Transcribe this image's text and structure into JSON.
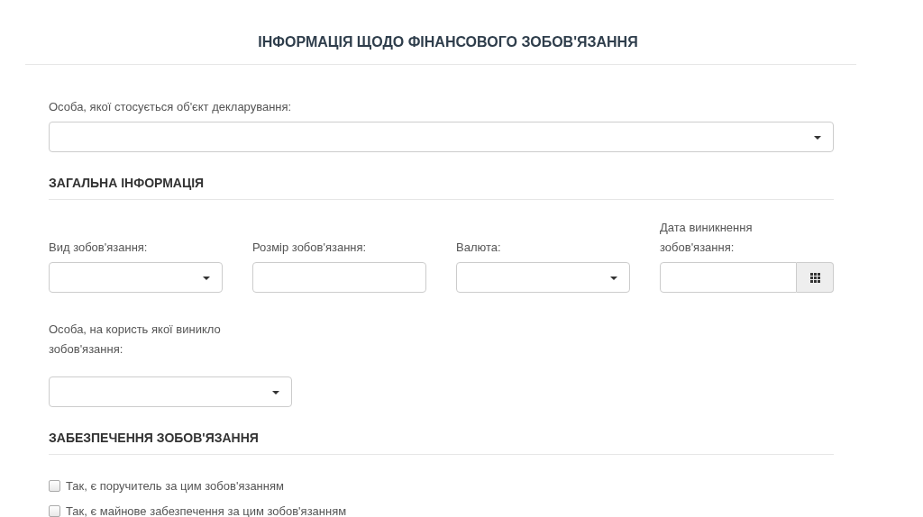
{
  "title": "ІНФОРМАЦІЯ ЩОДО ФІНАНСОВОГО ЗОБОВ'ЯЗАННЯ",
  "person_field": {
    "label": "Особа, якої стосується об'єкт декларування:",
    "kind": "select"
  },
  "sections": [
    {
      "heading": "ЗАГАЛЬНА ІНФОРМАЦІЯ",
      "fields": [
        {
          "label": "Вид зобов'язання:",
          "kind": "select"
        },
        {
          "label": "Розмір зобов'язання:",
          "kind": "text"
        },
        {
          "label": "Валюта:",
          "kind": "select"
        },
        {
          "label": "Дата виникнення зобов'язання:",
          "kind": "date"
        }
      ],
      "beneficiary_field": {
        "label": "Особа, на користь якої виникло зобов'язання:",
        "kind": "select"
      }
    },
    {
      "heading": "ЗАБЕЗПЕЧЕННЯ ЗОБОВ'ЯЗАННЯ",
      "checkboxes": [
        {
          "label": "Так, є поручитель за цим зобов'язанням",
          "checked": false
        },
        {
          "label": "Так, є майнове забезпечення за цим зобов'язанням",
          "checked": false
        }
      ]
    }
  ]
}
